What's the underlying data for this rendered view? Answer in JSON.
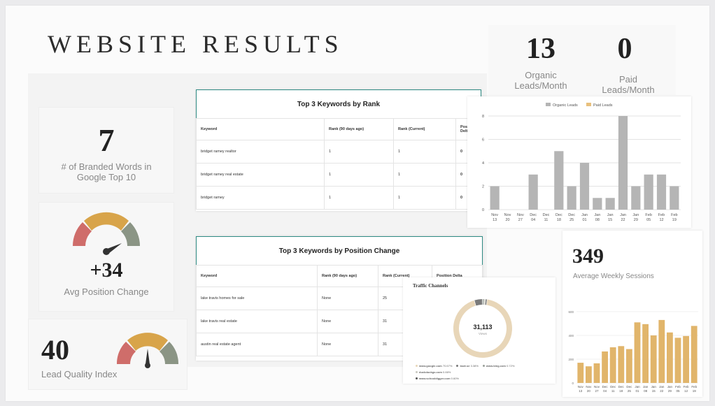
{
  "title": "WEBSITE RESULTS",
  "branded": {
    "value": "7",
    "label": "# of Branded Words in Google Top 10"
  },
  "avg_position": {
    "value": "+34",
    "label": "Avg Position Change"
  },
  "lead_quality": {
    "value": "40",
    "label": "Lead Quality Index"
  },
  "organic_leads": {
    "value": "13",
    "label": "Organic Leads/Month"
  },
  "paid_leads": {
    "value": "0",
    "label": "Paid Leads/Month"
  },
  "weekly_sessions": {
    "value": "349",
    "label": "Average Weekly Sessions"
  },
  "table_rank": {
    "title": "Top 3 Keywords by Rank",
    "headers": [
      "Keyword",
      "Rank (90 days ago)",
      "Rank (Current)",
      "Position Delta"
    ],
    "rows": [
      [
        "bridget ramey realtor",
        "1",
        "1",
        "0"
      ],
      [
        "bridget ramey real estate",
        "1",
        "1",
        "0"
      ],
      [
        "bridget ramey",
        "1",
        "1",
        "0"
      ]
    ]
  },
  "table_change": {
    "title": "Top 3 Keywords by Position Change",
    "headers": [
      "Keyword",
      "Rank (90 days ago)",
      "Rank (Current)",
      "Position Delta"
    ],
    "rows": [
      [
        "lake travis homes for sale",
        "None",
        "25",
        ""
      ],
      [
        "lake travis real estate",
        "None",
        "31",
        ""
      ],
      [
        "austin real estate agent",
        "None",
        "31",
        ""
      ]
    ]
  },
  "traffic": {
    "title": "Traffic Channels",
    "total": "31,113",
    "total_label": "Views",
    "legend": [
      {
        "label": "www.google.com",
        "value": "70.67%",
        "color": "#e8d6b8"
      },
      {
        "label": "bsdr.se",
        "value": "3.38%",
        "color": "#7a7a7a"
      },
      {
        "label": "www.bing.com",
        "value": "0.72%",
        "color": "#9aa09a"
      },
      {
        "label": "duckduckgo.com",
        "value": "0.66%",
        "color": "#c9c9c0"
      },
      {
        "label": "www.schooldigger.com",
        "value": "0.60%",
        "color": "#555555"
      }
    ]
  },
  "chart_data": [
    {
      "type": "bar",
      "legend": [
        "Organic Leads",
        "Paid Leads"
      ],
      "colors": {
        "organic": "#b5b5b5",
        "paid": "#e8c07d"
      },
      "categories": [
        "Nov 13",
        "Nov 20",
        "Nov 27",
        "Dec 04",
        "Dec 11",
        "Dec 18",
        "Dec 25",
        "Jan 01",
        "Jan 08",
        "Jan 15",
        "Jan 22",
        "Jan 29",
        "Feb 05",
        "Feb 12",
        "Feb 19"
      ],
      "series": [
        {
          "name": "Organic Leads",
          "values": [
            2,
            0,
            0,
            3,
            0,
            5,
            2,
            4,
            1,
            1,
            8,
            2,
            3,
            3,
            2
          ]
        },
        {
          "name": "Paid Leads",
          "values": [
            0,
            0,
            0,
            0,
            0,
            0,
            0,
            0,
            0,
            0,
            0,
            0,
            0,
            0,
            0
          ]
        }
      ],
      "yticks": [
        0,
        2,
        4,
        6,
        8
      ],
      "ylim": [
        0,
        8
      ],
      "legend_position": "top"
    },
    {
      "type": "bar",
      "color": "#e1b56b",
      "categories": [
        "Nov 13",
        "Nov 20",
        "Nov 27",
        "Dec 04",
        "Dec 11",
        "Dec 18",
        "Dec 25",
        "Jan 01",
        "Jan 08",
        "Jan 15",
        "Jan 22",
        "Jan 29",
        "Feb 05",
        "Feb 12",
        "Feb 19"
      ],
      "values": [
        170,
        140,
        165,
        265,
        300,
        310,
        285,
        510,
        495,
        400,
        530,
        425,
        380,
        395,
        480
      ],
      "yticks": [
        0,
        200,
        400,
        600
      ],
      "ylim": [
        0,
        600
      ]
    },
    {
      "type": "pie",
      "labels": [
        "www.google.com",
        "bsdr.se",
        "www.bing.com",
        "duckduckgo.com",
        "www.schooldigger.com"
      ],
      "values": [
        70.67,
        3.38,
        0.72,
        0.66,
        0.6
      ]
    }
  ]
}
